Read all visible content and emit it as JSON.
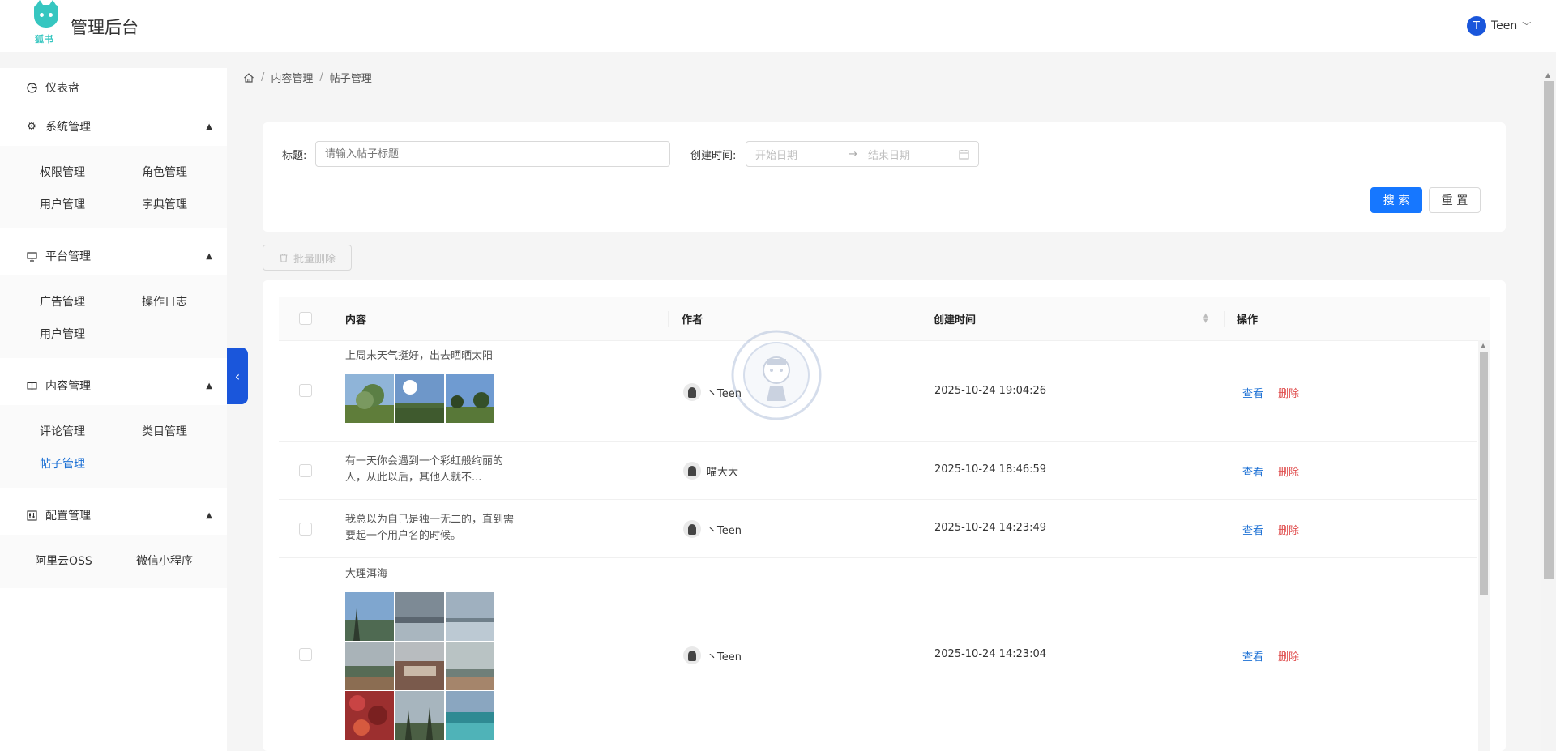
{
  "header": {
    "logo_text": "狐书",
    "title": "管理后台",
    "user": {
      "initial": "T",
      "name": "Teen"
    }
  },
  "sidebar": {
    "dashboard": "仪表盘",
    "groups": [
      {
        "label": "系统管理",
        "items": [
          "权限管理",
          "角色管理",
          "用户管理",
          "字典管理"
        ]
      },
      {
        "label": "平台管理",
        "items": [
          "广告管理",
          "操作日志",
          "用户管理"
        ]
      },
      {
        "label": "内容管理",
        "items": [
          "评论管理",
          "类目管理",
          "帖子管理"
        ]
      },
      {
        "label": "配置管理",
        "items": [
          "阿里云OSS",
          "微信小程序"
        ]
      }
    ],
    "active": "帖子管理"
  },
  "breadcrumb": [
    "内容管理",
    "帖子管理"
  ],
  "search": {
    "title_label": "标题:",
    "title_placeholder": "请输入帖子标题",
    "date_label": "创建时间:",
    "start_placeholder": "开始日期",
    "end_placeholder": "结束日期",
    "search_btn": "搜 索",
    "reset_btn": "重 置"
  },
  "batch_delete": "批量删除",
  "table": {
    "columns": [
      "内容",
      "作者",
      "创建时间",
      "操作"
    ],
    "rows": [
      {
        "content": "上周末天气挺好，出去晒晒太阳",
        "author": "丶Teen",
        "time": "2025-10-24 19:04:26",
        "images": 3
      },
      {
        "content": "有一天你会遇到一个彩虹般绚丽的人，从此以后，其他人就不...",
        "author": "喵大大",
        "time": "2025-10-24 18:46:59",
        "images": 0
      },
      {
        "content": "我总以为自己是独一无二的，直到需要起一个用户名的时候。",
        "author": "丶Teen",
        "time": "2025-10-24 14:23:49",
        "images": 0
      },
      {
        "content": "大理洱海",
        "author": "丶Teen",
        "time": "2025-10-24 14:23:04",
        "images": 9
      }
    ],
    "action_view": "查看",
    "action_delete": "删除"
  },
  "colors": {
    "primary": "#1677ff",
    "danger": "#e04f4f",
    "link": "#1a6fd4",
    "collapse": "#1a56db"
  }
}
